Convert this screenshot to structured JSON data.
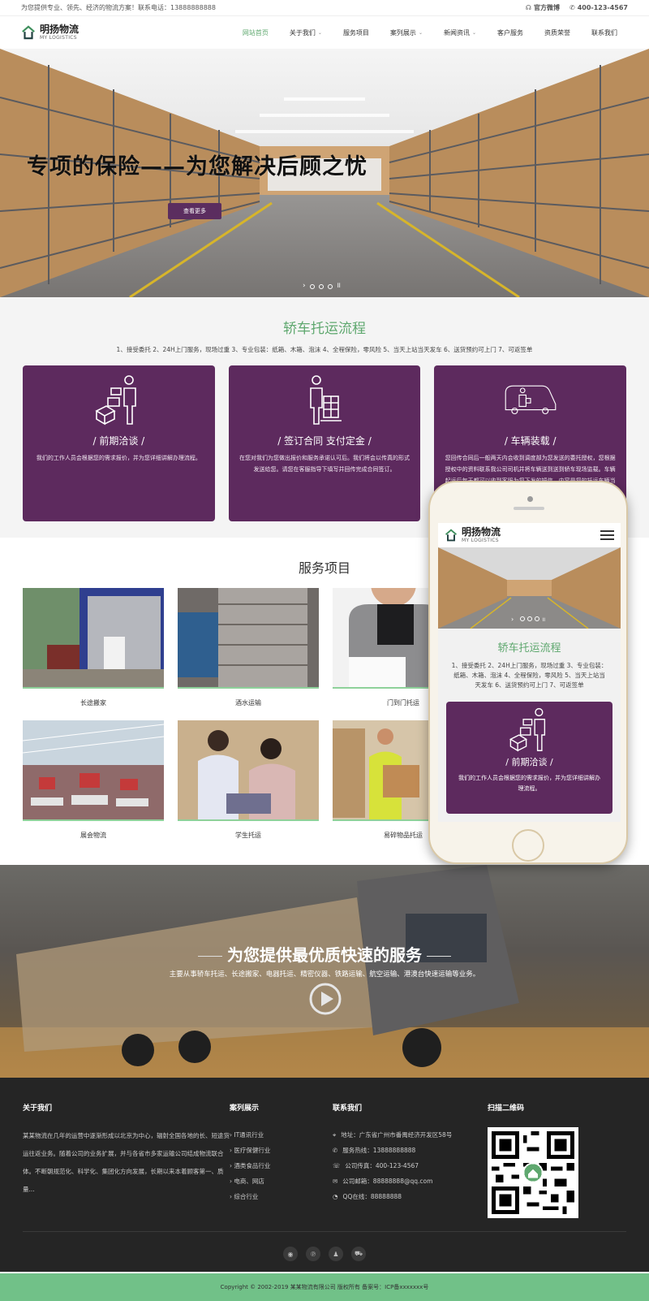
{
  "topbar": {
    "slogan": "为您提供专业、领先、经济的物流方案！联系电话：13888888888",
    "wechat": "官方微博",
    "phone": "400-123-4567"
  },
  "brand": {
    "name_cn": "明扬物流",
    "name_en": "MY LOGISTICS"
  },
  "nav": [
    {
      "label": "网站首页",
      "active": true,
      "caret": false
    },
    {
      "label": "关于我们",
      "caret": true
    },
    {
      "label": "服务项目",
      "caret": false
    },
    {
      "label": "案列展示",
      "caret": true
    },
    {
      "label": "新闻资讯",
      "caret": true
    },
    {
      "label": "客户服务",
      "caret": false
    },
    {
      "label": "资质荣誉",
      "caret": false
    },
    {
      "label": "联系我们",
      "caret": false
    }
  ],
  "hero": {
    "title": "专项的保险——为您解决后顾之忧",
    "button": "查看更多"
  },
  "process": {
    "title": "轿车托运流程",
    "subtitle": "1、接受委托 2、24H上门服务，现场过重 3、专业包装：纸箱、木箱、泡沫 4、全程保险，零风险 5、当天上站当天发车 6、送货预约可上门 7、可返签单",
    "cards": [
      {
        "title": "/ 前期洽谈 /",
        "text": "我们的工作人员会根据您的需求报价，并为您详细讲解办理流程。"
      },
      {
        "title": "/ 签订合同 支付定金 /",
        "text": "在您对我们为您做出报价和服务承诺认可后。我们将会以传真的形式发送给您。请您在客服指导下填写并回传完成合同签订。"
      },
      {
        "title": "/ 车辆装载 /",
        "text": "您回传合同后一般两天内会收到调度部为您发送的委托授权，您根据授权中的资料联系我公司司机并将车辆送到送到轿车现场监载。车辆起运后每天都可以收到客服为您下发的短信，内容是您的托运车辆当前的位置和运输情况。车辆到达目的地前的"
      }
    ]
  },
  "services": {
    "title": "服务项目",
    "items": [
      {
        "label": "长途搬家"
      },
      {
        "label": "酒水运输"
      },
      {
        "label": "门到门托运"
      },
      {
        "label": "展会物流"
      },
      {
        "label": "学生托运"
      },
      {
        "label": "易碎物品托运"
      }
    ]
  },
  "banner": {
    "title": "为您提供最优质快速的服务",
    "desc": "主要从事轿车托运、长途搬家、电器托运、精密仪器、铁路运输、航空运输、港澳台快速运输等业务。"
  },
  "footer": {
    "about": {
      "title": "关于我们",
      "text": "某某物流在几年的运营中逐渐形成以北京为中心，辐射全国各地的长、短途货运往返业务。随着公司的业务扩展，并与各省市多家运输公司结成物流联合体。不断朝规范化、科学化、集团化方向发展，长期以来本着顾客第一、质量..."
    },
    "cases": {
      "title": "案列展示",
      "items": [
        "IT通讯行业",
        "医疗保健行业",
        "酒类食品行业",
        "电商、网店",
        "综合行业"
      ]
    },
    "contact": {
      "title": "联系我们",
      "items": [
        {
          "icon": "location-icon",
          "text": "地址：广东省广州市番禺经济开发区58号"
        },
        {
          "icon": "phone-icon",
          "text": "服务热线：13888888888"
        },
        {
          "icon": "fax-icon",
          "text": "公司传真：400-123-4567"
        },
        {
          "icon": "mail-icon",
          "text": "公司邮箱：88888888@qq.com"
        },
        {
          "icon": "qq-icon",
          "text": "QQ在线：88888888"
        }
      ]
    },
    "qr": {
      "title": "扫描二维码"
    },
    "social": [
      "weibo-icon",
      "pinterest-icon",
      "qq-penguin-icon",
      "cart-icon"
    ],
    "copyright": "Copyright © 2002-2019 某某物流有限公司 版权所有 备案号：ICP备xxxxxxx号"
  },
  "phone": {
    "brand_cn": "明扬物流",
    "brand_en": "MY LOGISTICS",
    "title": "轿车托运流程",
    "subtitle": "1、接受委托 2、24H上门服务，现场过重 3、专业包装：纸箱、木箱、泡沫 4、全程保险，零风险 5、当天上站当天发车 6、送货预约可上门 7、可返签单",
    "card_title": "/ 前期洽谈 /",
    "card_text": "我们的工作人员会根据您的需求报价，并为您详细讲解办理流程。"
  },
  "colors": {
    "accent_green": "#5fa86f",
    "brand_purple": "#5d2a5e",
    "footer_bg": "#252525",
    "copyright_bg": "#71c188"
  }
}
